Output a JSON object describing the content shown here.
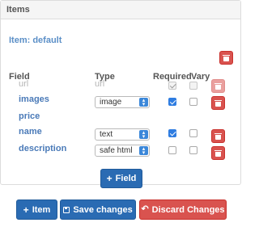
{
  "panel": {
    "title": "Items"
  },
  "item": {
    "title": "Item: default"
  },
  "headers": {
    "field": "Field",
    "type": "Type",
    "required": "Required",
    "vary": "Vary"
  },
  "rows": [
    {
      "field": "url",
      "type": "url",
      "required": true,
      "vary": false,
      "disabled": true
    },
    {
      "field": "images",
      "type": "image",
      "required": true,
      "vary": false
    },
    {
      "field": "price"
    },
    {
      "field": "name",
      "type": "text",
      "required": true,
      "vary": false
    },
    {
      "field": "description",
      "type": "safe html",
      "required": false,
      "vary": false
    }
  ],
  "buttons": {
    "add_field": "Field",
    "add_item": "Item",
    "save": "Save changes",
    "discard": "Discard Changes"
  },
  "icons": {
    "delete": "trash-icon",
    "add": "plus-icon",
    "save": "floppy-disk-icon",
    "discard": "undo-icon",
    "select": "up-down-arrow-icon"
  },
  "colors": {
    "primary": "#2a6bb3",
    "danger": "#d9534f",
    "label": "#4a7ab8",
    "checkbox": "#2f7de1"
  }
}
